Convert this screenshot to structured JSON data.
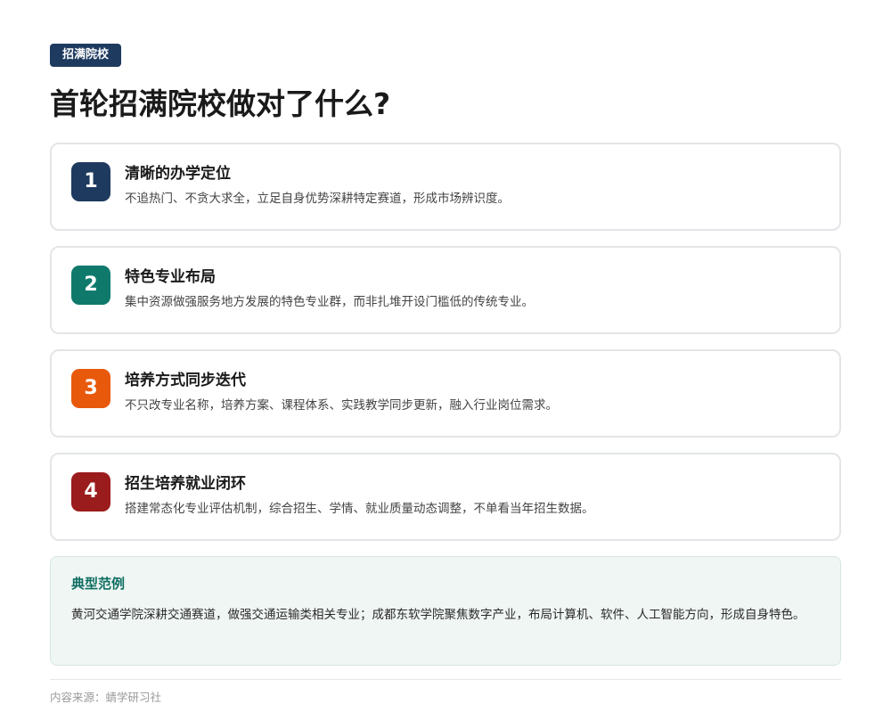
{
  "tag": "招满院校",
  "title": "首轮招满院校做对了什么?",
  "items": [
    {
      "number": "1",
      "color": "#1e3a5f",
      "title": "清晰的办学定位",
      "desc": "不追热门、不贪大求全，立足自身优势深耕特定赛道，形成市场辨识度。"
    },
    {
      "number": "2",
      "color": "#0f7a6c",
      "title": "特色专业布局",
      "desc": "集中资源做强服务地方发展的特色专业群，而非扎堆开设门槛低的传统专业。"
    },
    {
      "number": "3",
      "color": "#e8590c",
      "title": "培养方式同步迭代",
      "desc": "不只改专业名称，培养方案、课程体系、实践教学同步更新，融入行业岗位需求。"
    },
    {
      "number": "4",
      "color": "#9b1c1c",
      "title": "招生培养就业闭环",
      "desc": "搭建常态化专业评估机制，综合招生、学情、就业质量动态调整，不单看当年招生数据。"
    }
  ],
  "example": {
    "title": "典型范例",
    "body": "黄河交通学院深耕交通赛道，做强交通运输类相关专业；成都东软学院聚焦数字产业，布局计算机、软件、人工智能方向，形成自身特色。"
  },
  "source": "内容来源：蜻学研习社"
}
